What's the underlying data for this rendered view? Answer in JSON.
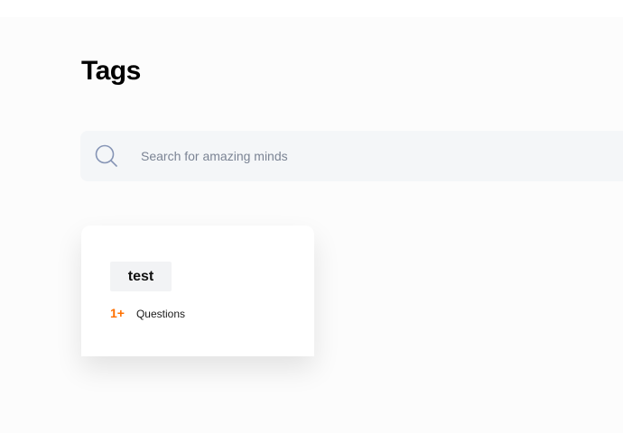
{
  "page": {
    "title": "Tags"
  },
  "search": {
    "placeholder": "Search for amazing minds",
    "icon": "search-icon"
  },
  "tags": [
    {
      "name": "test",
      "count": "1+",
      "count_label": "Questions"
    }
  ],
  "colors": {
    "accent": "#ff7000",
    "background": "#fcfcfc",
    "search_bg": "#f4f6f8",
    "tag_pill_bg": "#f2f3f5",
    "search_icon": "#8594b5"
  }
}
